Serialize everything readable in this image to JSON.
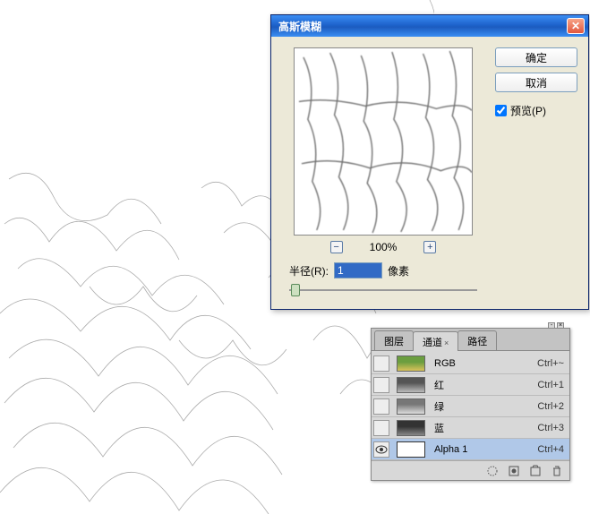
{
  "dialog": {
    "title": "高斯模糊",
    "ok_label": "确定",
    "cancel_label": "取消",
    "preview_label": "预览(P)",
    "zoom_pct": "100%",
    "radius_label": "半径(R):",
    "radius_value": "1",
    "radius_unit": "像素"
  },
  "panel": {
    "tabs": {
      "layers": "图层",
      "channels": "通道",
      "paths": "路径"
    },
    "channels": [
      {
        "name": "RGB",
        "shortcut": "Ctrl+~",
        "thumb": "rgb"
      },
      {
        "name": "红",
        "shortcut": "Ctrl+1",
        "thumb": "red"
      },
      {
        "name": "绿",
        "shortcut": "Ctrl+2",
        "thumb": "green"
      },
      {
        "name": "蓝",
        "shortcut": "Ctrl+3",
        "thumb": "blue"
      },
      {
        "name": "Alpha 1",
        "shortcut": "Ctrl+4",
        "thumb": "alpha"
      }
    ]
  }
}
